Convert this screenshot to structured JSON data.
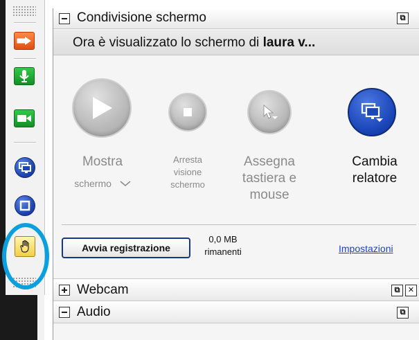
{
  "toolbar": {
    "items": [
      {
        "icon": "arrow-right-icon",
        "color": "#f06a26"
      },
      {
        "icon": "microphone-icon",
        "color": "#22b03a"
      },
      {
        "icon": "webcam-icon",
        "color": "#22b03a"
      },
      {
        "icon": "share-screen-icon",
        "color": "#1a46b8"
      },
      {
        "icon": "stop-square-icon",
        "color": "#1a46b8"
      },
      {
        "icon": "raise-hand-icon",
        "color": "#f2cf44"
      }
    ],
    "highlight_color": "#0aa0e0"
  },
  "screen_share": {
    "title": "Condivisione schermo",
    "viewing_prefix": "Ora è visualizzato lo schermo di ",
    "viewing_name": "laura v...",
    "buttons": {
      "show": {
        "label": "Mostra",
        "dropdown": "schermo",
        "icon": "play-icon"
      },
      "stop": {
        "line1": "Arresta",
        "line2": "visione",
        "line3": "schermo",
        "icon": "stop-icon"
      },
      "assign": {
        "line1": "Assegna",
        "line2": "tastiera e",
        "line3": "mouse",
        "icon": "cursor-icon"
      },
      "change": {
        "line1": "Cambia",
        "line2": "relatore",
        "icon": "monitor-icon"
      }
    },
    "record_button": "Avvia registrazione",
    "storage_value": "0,0 MB",
    "storage_label": "rimanenti",
    "settings_link": "Impostazioni"
  },
  "webcam": {
    "title": "Webcam"
  },
  "audio": {
    "title": "Audio"
  },
  "colors": {
    "accent_blue": "#1a46b8",
    "link": "#1a3fd0",
    "disabled_text": "#8a8a8a"
  }
}
